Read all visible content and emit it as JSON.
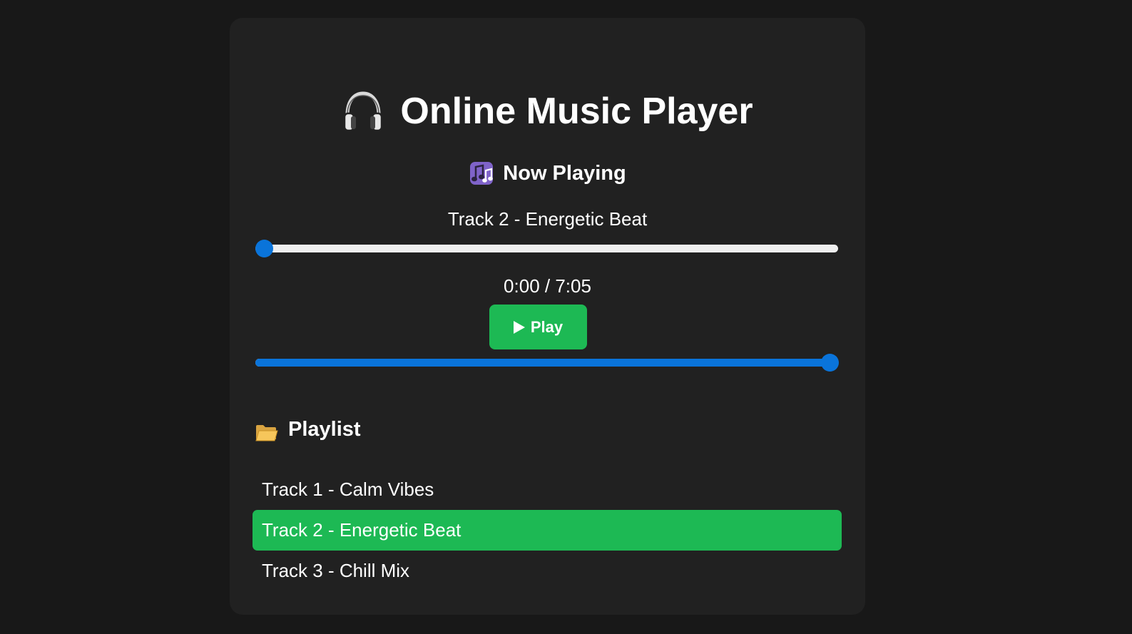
{
  "app": {
    "title": "Online Music Player"
  },
  "now_playing": {
    "heading": "Now Playing",
    "track_title": "Track 2 - Energetic Beat",
    "time_display": "0:00 / 7:05",
    "progress_fraction": 0.0
  },
  "controls": {
    "play_label": "Play",
    "volume_fraction": 1.0
  },
  "playlist": {
    "heading": "Playlist",
    "tracks": [
      {
        "label": "Track 1 - Calm Vibes",
        "active": false
      },
      {
        "label": "Track 2 - Energetic Beat",
        "active": true
      },
      {
        "label": "Track 3 - Chill Mix",
        "active": false
      }
    ]
  },
  "colors": {
    "page_background": "#181818",
    "card_background": "#212121",
    "accent_green": "#1db954",
    "slider_blue": "#0a74da",
    "slider_track": "#efefef",
    "text": "#ffffff"
  },
  "icons": {
    "title_icon": "headphones-icon",
    "now_playing_icon": "music-notes-icon",
    "play_icon": "play-triangle-icon",
    "playlist_icon": "open-folder-icon"
  }
}
